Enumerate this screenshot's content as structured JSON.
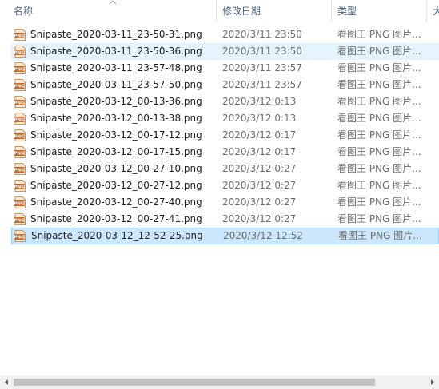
{
  "columns": {
    "name": "名称",
    "date": "修改日期",
    "type": "类型",
    "size": "大"
  },
  "files": [
    {
      "name": "Snipaste_2020-03-11_23-50-31.png",
      "date": "2020/3/11 23:50",
      "type": "看图王 PNG 图片...",
      "state": "normal"
    },
    {
      "name": "Snipaste_2020-03-11_23-50-36.png",
      "date": "2020/3/11 23:50",
      "type": "看图王 PNG 图片...",
      "state": "hover"
    },
    {
      "name": "Snipaste_2020-03-11_23-57-48.png",
      "date": "2020/3/11 23:57",
      "type": "看图王 PNG 图片...",
      "state": "normal"
    },
    {
      "name": "Snipaste_2020-03-11_23-57-50.png",
      "date": "2020/3/11 23:57",
      "type": "看图王 PNG 图片...",
      "state": "normal"
    },
    {
      "name": "Snipaste_2020-03-12_00-13-36.png",
      "date": "2020/3/12 0:13",
      "type": "看图王 PNG 图片...",
      "state": "normal"
    },
    {
      "name": "Snipaste_2020-03-12_00-13-38.png",
      "date": "2020/3/12 0:13",
      "type": "看图王 PNG 图片...",
      "state": "normal"
    },
    {
      "name": "Snipaste_2020-03-12_00-17-12.png",
      "date": "2020/3/12 0:17",
      "type": "看图王 PNG 图片...",
      "state": "normal"
    },
    {
      "name": "Snipaste_2020-03-12_00-17-15.png",
      "date": "2020/3/12 0:17",
      "type": "看图王 PNG 图片...",
      "state": "normal"
    },
    {
      "name": "Snipaste_2020-03-12_00-27-10.png",
      "date": "2020/3/12 0:27",
      "type": "看图王 PNG 图片...",
      "state": "normal"
    },
    {
      "name": "Snipaste_2020-03-12_00-27-12.png",
      "date": "2020/3/12 0:27",
      "type": "看图王 PNG 图片...",
      "state": "normal"
    },
    {
      "name": "Snipaste_2020-03-12_00-27-40.png",
      "date": "2020/3/12 0:27",
      "type": "看图王 PNG 图片...",
      "state": "normal"
    },
    {
      "name": "Snipaste_2020-03-12_00-27-41.png",
      "date": "2020/3/12 0:27",
      "type": "看图王 PNG 图片...",
      "state": "normal"
    },
    {
      "name": "Snipaste_2020-03-12_12-52-25.png",
      "date": "2020/3/12 12:52",
      "type": "看图王 PNG 图片...",
      "state": "selected"
    }
  ],
  "file_icon": {
    "name": "png-file-icon",
    "label": "PNG"
  },
  "icons": {
    "sort": "sort-ascending-icon",
    "scroll_left": "chevron-left-icon",
    "scroll_right": "chevron-right-icon"
  }
}
